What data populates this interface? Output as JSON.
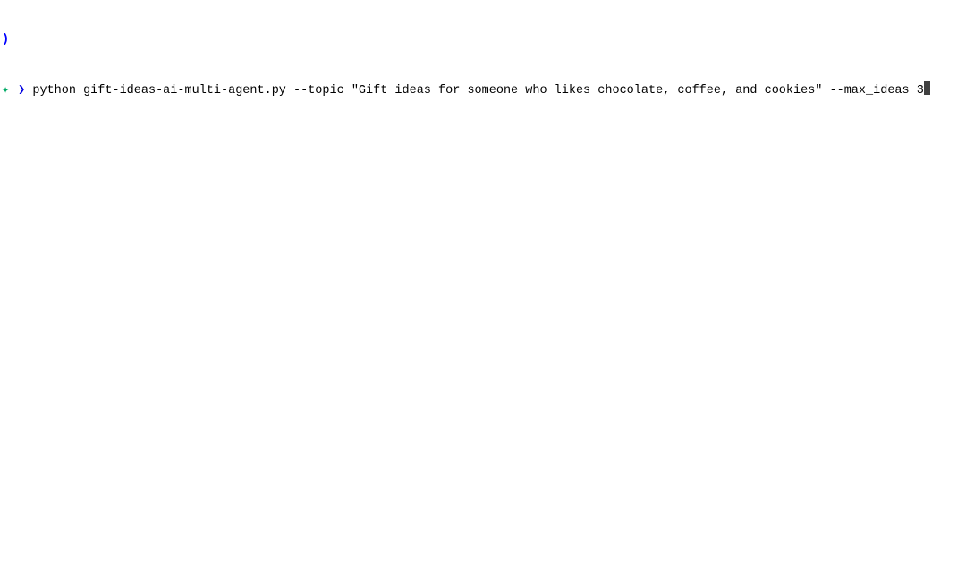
{
  "terminal": {
    "prev_line": ")",
    "prompt_asterisk": "✦",
    "prompt_arrow": "❯",
    "command": "python gift-ideas-ai-multi-agent.py --topic \"Gift ideas for someone who likes chocolate, coffee, and cookies\" --max_ideas 3"
  }
}
